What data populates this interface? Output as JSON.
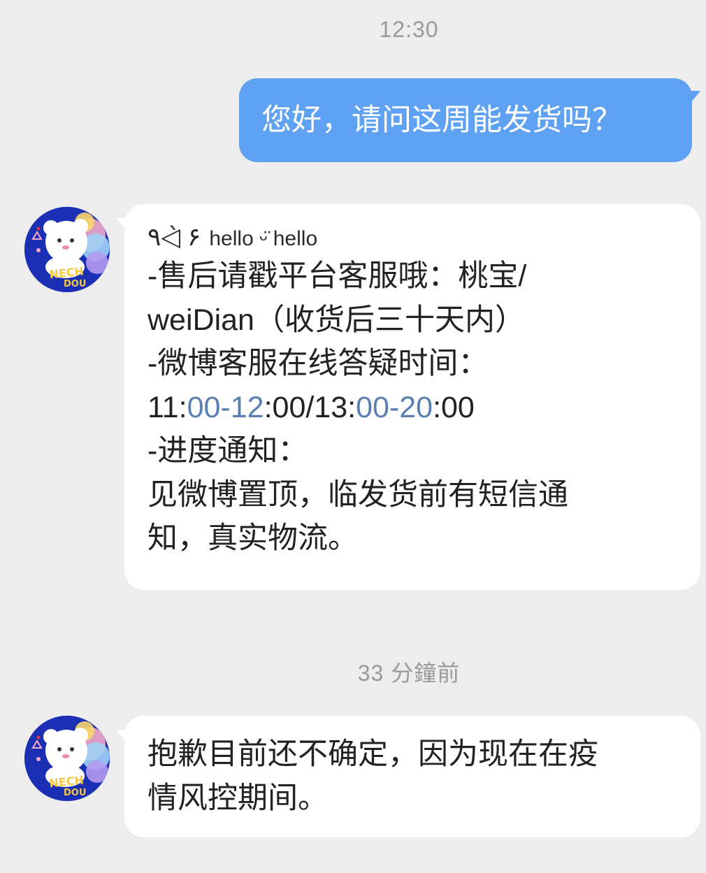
{
  "chat": {
    "timestamp_1": "12:30",
    "outgoing_message": "您好，请问这周能发货吗？",
    "incoming_1": {
      "header_deco": "٩◁̀ ۶",
      "header_text": "hello ᵕ̈ hello",
      "lines": {
        "l1": "-售后请戳平台客服哦：桃宝/",
        "l2": "weiDian（收货后三十天内）",
        "l3": "-微博客服在线答疑时间：",
        "l4_a": "11:",
        "l4_b": "00-12",
        "l4_c": ":00/13:",
        "l4_d": "00-20",
        "l4_e": ":00",
        "l5": "-进度通知：",
        "l6": "见微博置顶，临发货前有短信通",
        "l7": "知，真实物流。"
      }
    },
    "timestamp_2": "33 分鐘前",
    "incoming_2": {
      "l1": "抱歉目前还不确定，因为现在在疫",
      "l2": "情风控期间。"
    }
  },
  "avatar": {
    "label_line1": "NECH",
    "label_line2": "DOU"
  },
  "colors": {
    "background": "#ededed",
    "outgoing_bubble": "#5fa2f3",
    "incoming_bubble": "#ffffff",
    "timestamp_text": "#9a9a9a",
    "link_text": "#5a7fb0",
    "avatar_bg": "#1b2fb5"
  }
}
